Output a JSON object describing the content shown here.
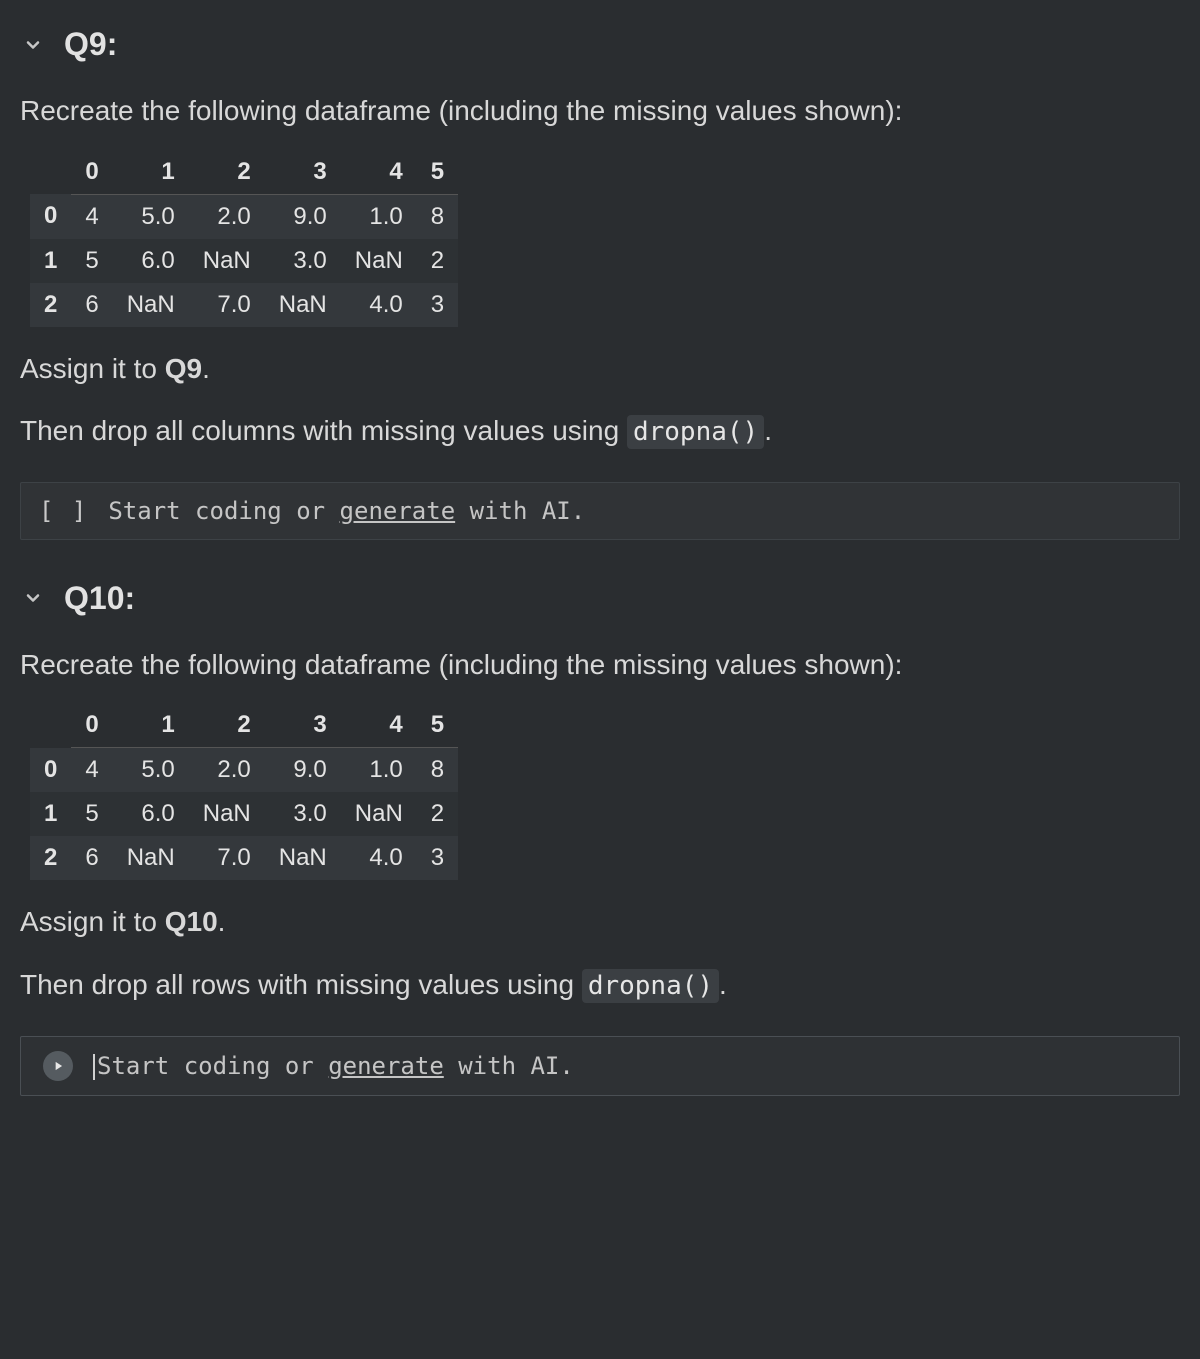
{
  "sections": [
    {
      "title": "Q9:",
      "intro": "Recreate the following dataframe (including the missing values shown):",
      "assign_prefix": "Assign it to ",
      "assign_var": "Q9",
      "assign_suffix": ".",
      "then_prefix": "Then drop all columns with missing values using ",
      "then_code": "dropna()",
      "then_suffix": ".",
      "table": {
        "columns": [
          "0",
          "1",
          "2",
          "3",
          "4",
          "5"
        ],
        "index": [
          "0",
          "1",
          "2"
        ],
        "rows": [
          [
            "4",
            "5.0",
            "2.0",
            "9.0",
            "1.0",
            "8"
          ],
          [
            "5",
            "6.0",
            "NaN",
            "3.0",
            "NaN",
            "2"
          ],
          [
            "6",
            "NaN",
            "7.0",
            "NaN",
            "4.0",
            "3"
          ]
        ]
      },
      "cell": {
        "kind": "idle",
        "gutter": "[ ]",
        "prefix": "Start coding or ",
        "link": "generate",
        "suffix": " with AI."
      }
    },
    {
      "title": "Q10:",
      "intro": "Recreate the following dataframe (including the missing values shown):",
      "assign_prefix": "Assign it to ",
      "assign_var": "Q10",
      "assign_suffix": ".",
      "then_prefix": "Then drop all rows with missing values using ",
      "then_code": "dropna()",
      "then_suffix": ".",
      "table": {
        "columns": [
          "0",
          "1",
          "2",
          "3",
          "4",
          "5"
        ],
        "index": [
          "0",
          "1",
          "2"
        ],
        "rows": [
          [
            "4",
            "5.0",
            "2.0",
            "9.0",
            "1.0",
            "8"
          ],
          [
            "5",
            "6.0",
            "NaN",
            "3.0",
            "NaN",
            "2"
          ],
          [
            "6",
            "NaN",
            "7.0",
            "NaN",
            "4.0",
            "3"
          ]
        ]
      },
      "cell": {
        "kind": "active",
        "prefix": "Start coding or ",
        "link": "generate",
        "suffix": " with AI."
      }
    }
  ]
}
